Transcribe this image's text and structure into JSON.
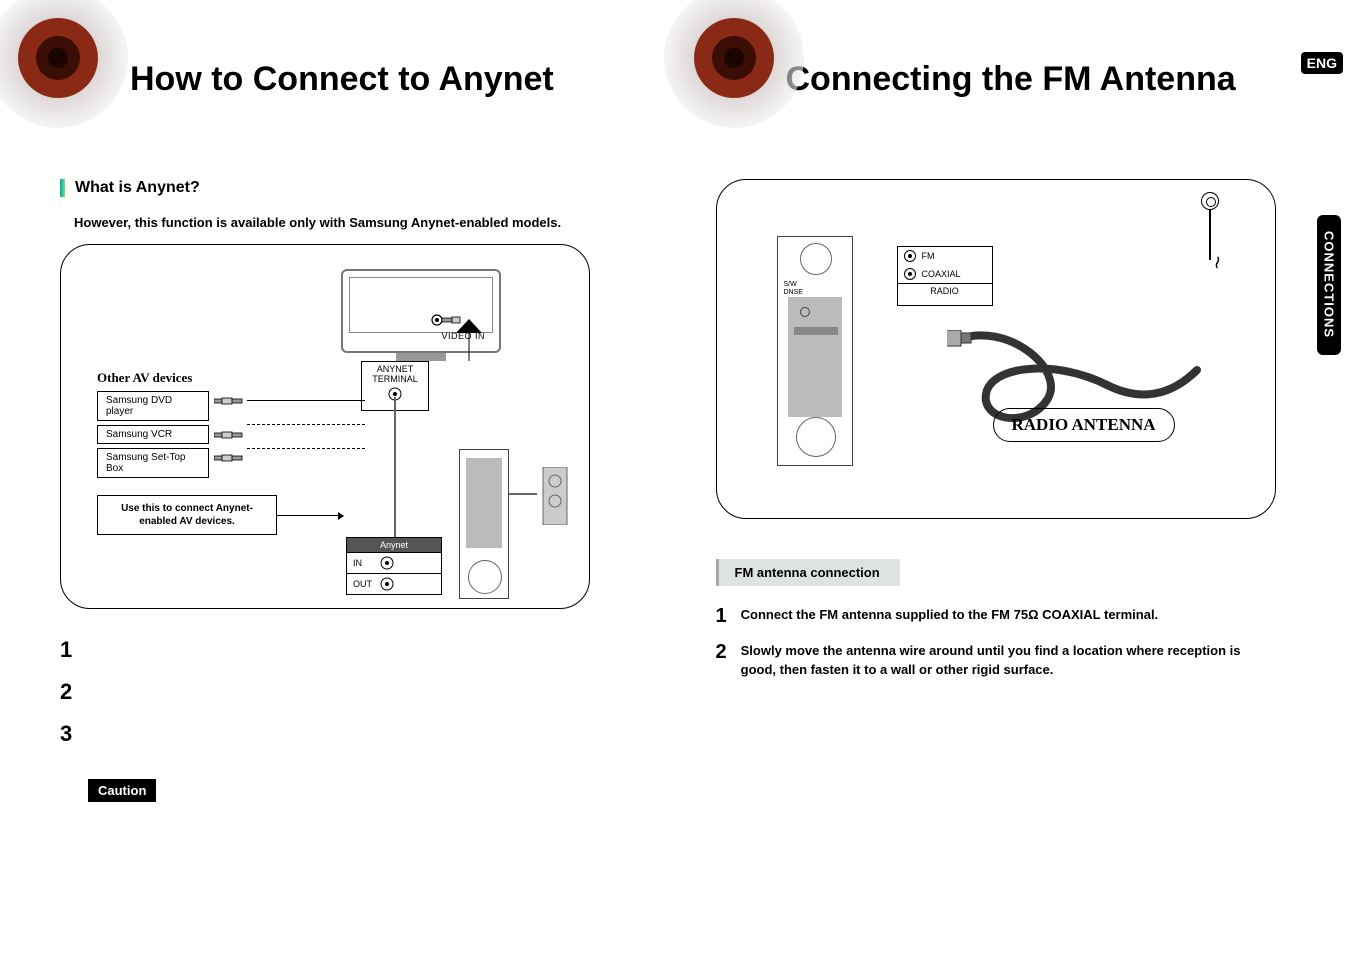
{
  "lang_badge": "ENG",
  "side_tab": "CONNECTIONS",
  "left": {
    "heading": "How to Connect to Anynet",
    "sub_heading": "What is Anynet?",
    "intro": "However, this function is available only with Samsung Anynet-enabled models.",
    "tv_video_in": "VIDEO IN",
    "anynet_terminal": "ANYNET TERMINAL",
    "other_av": "Other AV devices",
    "av_devices": [
      "Samsung DVD player",
      "Samsung VCR",
      "Samsung Set-Top Box"
    ],
    "callout": "Use this to connect Anynet-enabled AV devices.",
    "anynet_io_title": "Anynet",
    "anynet_io_in": "IN",
    "anynet_io_out": "OUT",
    "steps": [
      "1",
      "2",
      "3"
    ],
    "caution": "Caution"
  },
  "right": {
    "heading": "Connecting the FM Antenna",
    "radio_panel_fm": "FM",
    "radio_panel_coax": "COAXIAL",
    "radio_panel_title": "RADIO",
    "rear_label_line1": "S/W",
    "rear_label_line2": "DNSE",
    "antenna_label": "RADIO ANTENNA",
    "section_label": "FM antenna connection",
    "steps": [
      {
        "num": "1",
        "text": "Connect the FM antenna supplied to the FM 75Ω COAXIAL terminal."
      },
      {
        "num": "2",
        "text": "Slowly move the antenna wire around until you find a location where reception is good, then fasten it to a wall or other rigid surface."
      }
    ]
  }
}
